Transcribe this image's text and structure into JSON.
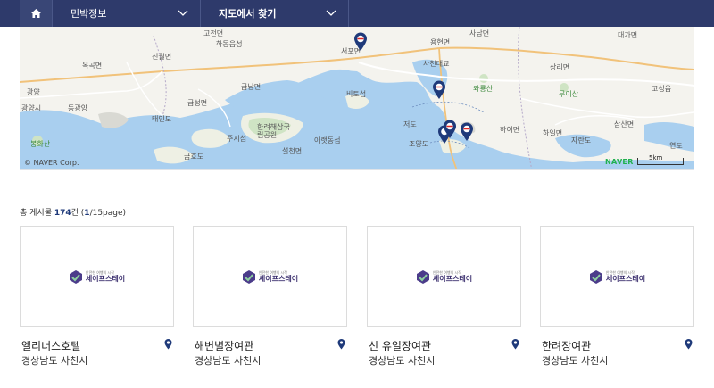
{
  "nav": {
    "home_icon": "home-icon",
    "select1": "민박정보",
    "select2": "지도에서 찾기"
  },
  "map": {
    "labels": [
      {
        "text": "고전면",
        "cls": ""
      },
      {
        "text": "하동읍성",
        "cls": ""
      },
      {
        "text": "진월면",
        "cls": ""
      },
      {
        "text": "옥곡면",
        "cls": ""
      },
      {
        "text": "광양",
        "cls": ""
      },
      {
        "text": "동광양",
        "cls": ""
      },
      {
        "text": "광양시",
        "cls": ""
      },
      {
        "text": "태인도",
        "cls": ""
      },
      {
        "text": "금성면",
        "cls": ""
      },
      {
        "text": "금남면",
        "cls": ""
      },
      {
        "text": "한려해상국립공원",
        "cls": ""
      },
      {
        "text": "주지섬",
        "cls": ""
      },
      {
        "text": "설천면",
        "cls": ""
      },
      {
        "text": "금호도",
        "cls": ""
      },
      {
        "text": "서포면",
        "cls": ""
      },
      {
        "text": "비토섬",
        "cls": ""
      },
      {
        "text": "아랫동섬",
        "cls": ""
      },
      {
        "text": "용현면",
        "cls": ""
      },
      {
        "text": "사천대교",
        "cls": ""
      },
      {
        "text": "사남면",
        "cls": ""
      },
      {
        "text": "와룡산",
        "cls": "green"
      },
      {
        "text": "저도",
        "cls": ""
      },
      {
        "text": "조양도",
        "cls": ""
      },
      {
        "text": "하이면",
        "cls": ""
      },
      {
        "text": "하일면",
        "cls": ""
      },
      {
        "text": "자란도",
        "cls": ""
      },
      {
        "text": "상리면",
        "cls": ""
      },
      {
        "text": "무이산",
        "cls": "green"
      },
      {
        "text": "대가면",
        "cls": ""
      },
      {
        "text": "고성읍",
        "cls": ""
      },
      {
        "text": "삼산면",
        "cls": ""
      },
      {
        "text": "봉화산",
        "cls": "green"
      },
      {
        "text": "연도",
        "cls": ""
      }
    ],
    "copyright": "© NAVER Corp.",
    "brand": "NAVER",
    "scale": "5km"
  },
  "results": {
    "prefix": "총 게시물 ",
    "count": "174",
    "unit": "건 (",
    "page": "1",
    "suffix": "/15page)"
  },
  "cards": [
    {
      "name": "엘리너스호텔",
      "region": "경상남도 사천시",
      "logo_small": "안전한 여행의 시작",
      "logo_main": "세이프스테이"
    },
    {
      "name": "해변별장여관",
      "region": "경상남도 사천시",
      "logo_small": "안전한 여행의 시작",
      "logo_main": "세이프스테이"
    },
    {
      "name": "신 유일장여관",
      "region": "경상남도 사천시",
      "logo_small": "안전한 여행의 시작",
      "logo_main": "세이프스테이"
    },
    {
      "name": "한려장여관",
      "region": "경상남도 사천시",
      "logo_small": "안전한 여행의 시작",
      "logo_main": "세이프스테이"
    }
  ],
  "colors": {
    "nav_bg": "#2e3a6b",
    "accent": "#1f3a7a",
    "sea": "#a9cfef",
    "land": "#f4f3ee"
  }
}
